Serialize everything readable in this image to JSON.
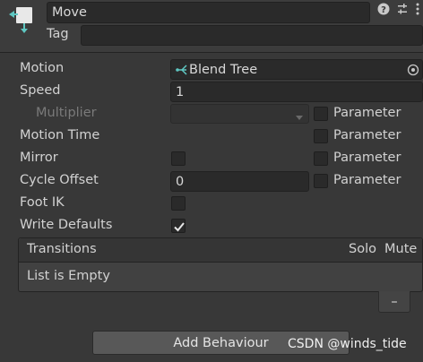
{
  "header": {
    "name_value": "Move",
    "tag_label": "Tag",
    "tag_value": "",
    "icons": [
      "help-icon",
      "preset-icon",
      "more-icon"
    ]
  },
  "fields": {
    "motion_label": "Motion",
    "motion_value": "Blend Tree",
    "speed_label": "Speed",
    "speed_value": "1",
    "multiplier_label": "Multiplier",
    "multiplier_value": "",
    "motion_time_label": "Motion Time",
    "mirror_label": "Mirror",
    "mirror_checked": false,
    "cycle_offset_label": "Cycle Offset",
    "cycle_offset_value": "0",
    "foot_ik_label": "Foot IK",
    "foot_ik_checked": false,
    "write_defaults_label": "Write Defaults",
    "write_defaults_checked": true,
    "parameter_label": "Parameter"
  },
  "transitions": {
    "header": "Transitions",
    "solo_label": "Solo",
    "mute_label": "Mute",
    "empty_text": "List is Empty",
    "remove_label": "–"
  },
  "footer": {
    "add_behaviour_label": "Add Behaviour",
    "watermark": "CSDN @winds_tide"
  },
  "colors": {
    "background": "#383838",
    "field": "#2a2a2a",
    "text": "#d2d2d2",
    "dim_text": "#7a7a7a",
    "state_icon_accent": "#5fc7c2"
  }
}
